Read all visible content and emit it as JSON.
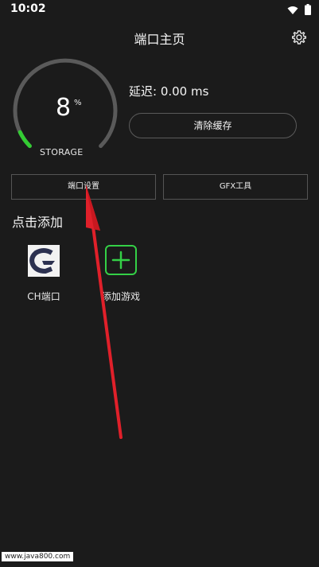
{
  "status_bar": {
    "time": "10:02",
    "icons": [
      "wifi-icon",
      "battery-icon"
    ]
  },
  "header": {
    "title": "端口主页",
    "settings_icon": "gear-icon"
  },
  "gauge": {
    "value": "8",
    "unit": "%",
    "label": "STORAGE",
    "fill_percent": 8,
    "track_color": "#5a5a5a",
    "fill_color": "#33cc33"
  },
  "latency": {
    "text": "延迟: 0.00 ms"
  },
  "buttons": {
    "clear_cache": "清除缓存",
    "port_settings": "端口设置",
    "gfx_tools": "GFX工具"
  },
  "section": {
    "title": "点击添加"
  },
  "apps": [
    {
      "label": "CH端口",
      "icon": "ch-logo-icon"
    },
    {
      "label": "添加游戏",
      "icon": "plus-icon",
      "accent": "#34d046"
    }
  ],
  "annotation": {
    "arrow_color": "#e0202a"
  },
  "watermark": "www.java800.com"
}
